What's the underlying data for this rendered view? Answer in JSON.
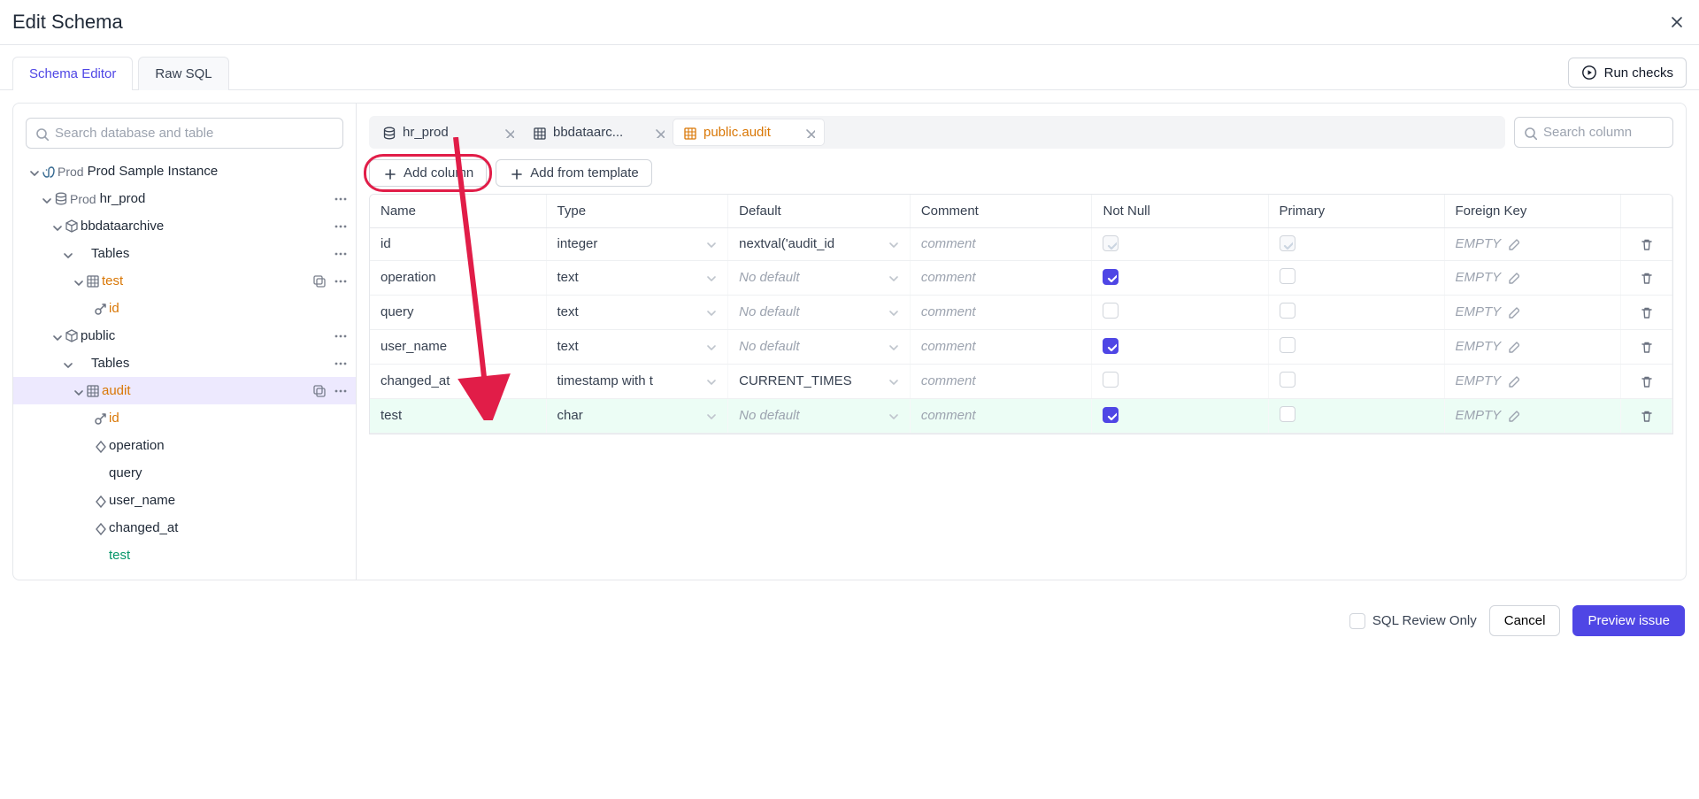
{
  "header": {
    "title": "Edit Schema"
  },
  "tabs": {
    "schema_editor": "Schema Editor",
    "raw_sql": "Raw SQL",
    "run_checks": "Run checks"
  },
  "sidebar": {
    "search_placeholder": "Search database and table",
    "instance_env": "Prod",
    "instance_name": "Prod Sample Instance",
    "db_env": "Prod",
    "db_name": "hr_prod",
    "schemas": [
      {
        "name": "bbdataarchive",
        "tables_label": "Tables",
        "tables": [
          {
            "name": "test",
            "highlight": "orange",
            "columns": [
              {
                "name": "id",
                "icon": "key",
                "color": "orange"
              }
            ]
          }
        ]
      },
      {
        "name": "public",
        "tables_label": "Tables",
        "tables": [
          {
            "name": "audit",
            "highlight": "orange",
            "selected": true,
            "columns": [
              {
                "name": "id",
                "icon": "key",
                "color": "orange"
              },
              {
                "name": "operation",
                "icon": "diamond"
              },
              {
                "name": "query",
                "icon": "none"
              },
              {
                "name": "user_name",
                "icon": "diamond"
              },
              {
                "name": "changed_at",
                "icon": "diamond"
              },
              {
                "name": "test",
                "icon": "none",
                "color": "green"
              }
            ]
          }
        ]
      }
    ]
  },
  "editor": {
    "tabs": [
      {
        "icon": "db",
        "label": "hr_prod",
        "active": false
      },
      {
        "icon": "table",
        "label": "bbdataarc...",
        "active": false
      },
      {
        "icon": "table",
        "label": "public.audit",
        "active": true
      }
    ],
    "search_placeholder": "Search column",
    "add_column": "Add column",
    "add_template": "Add from template",
    "headers": {
      "name": "Name",
      "type": "Type",
      "default": "Default",
      "comment": "Comment",
      "notnull": "Not Null",
      "primary": "Primary",
      "fk": "Foreign Key"
    },
    "fk_empty": "EMPTY",
    "default_placeholder": "No default",
    "comment_placeholder": "comment",
    "rows": [
      {
        "name": "id",
        "type": "integer",
        "default": "nextval('audit_id",
        "notnull": "disabled-checked",
        "primary": "disabled-checked",
        "new": false
      },
      {
        "name": "operation",
        "type": "text",
        "default": "",
        "notnull": "checked",
        "primary": "",
        "new": false
      },
      {
        "name": "query",
        "type": "text",
        "default": "",
        "notnull": "",
        "primary": "",
        "new": false
      },
      {
        "name": "user_name",
        "type": "text",
        "default": "",
        "notnull": "checked",
        "primary": "",
        "new": false
      },
      {
        "name": "changed_at",
        "type": "timestamp with t",
        "default": "CURRENT_TIMES",
        "notnull": "",
        "primary": "",
        "new": false
      },
      {
        "name": "test",
        "type": "char",
        "default": "",
        "notnull": "checked",
        "primary": "",
        "new": true
      }
    ]
  },
  "footer": {
    "sql_review": "SQL Review Only",
    "cancel": "Cancel",
    "preview": "Preview issue"
  }
}
